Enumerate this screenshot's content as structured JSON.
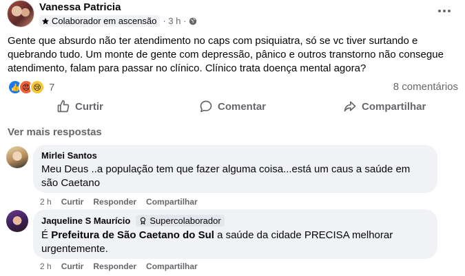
{
  "post": {
    "author": "Vanessa Patricia",
    "badge": "Colaborador em ascensão",
    "time": "· 3 h ·",
    "text": "Gente que absurdo não ter atendimento no caps com psiquiatra, só se vc tiver surtando e quebrando tudo. Um monte de gente com depressão, pânico e outros transtorno não consegue atendimento, falam para passar no clínico. Clínico trata doença mental agora?",
    "reaction_count": "7",
    "comments_count": "8 comentários"
  },
  "actions": {
    "like": "Curtir",
    "comment": "Comentar",
    "share": "Compartilhar"
  },
  "see_more": "Ver mais respostas",
  "comments": [
    {
      "author": "Mirlei Santos",
      "text": "Meu Deus ..a população tem que fazer alguma coisa...está um caus a saúde em são Caetano",
      "time": "2 h",
      "like": "Curtir",
      "reply": "Responder",
      "share": "Compartilhar"
    },
    {
      "author": "Jaqueline S Maurício",
      "badge": "Supercolaborador",
      "mention": "Prefeitura de São Caetano do Sul",
      "text_rest": " a saúde da cidade PRECISA melhorar urgentemente.",
      "text_prefix": "É ",
      "time": "2 h",
      "like": "Curtir",
      "reply": "Responder",
      "share": "Compartilhar"
    }
  ],
  "colors": {
    "primary_text": "#050505",
    "secondary_text": "#65676b",
    "bubble_bg": "#f0f2f5",
    "like_blue": "#1877f2"
  },
  "icons": {
    "badge": "star-icon",
    "privacy": "globe-icon",
    "menu": "more-dots-icon",
    "like": "thumbs-up-icon",
    "comment": "speech-bubble-icon",
    "share": "share-arrow-icon",
    "super_badge": "award-icon"
  }
}
